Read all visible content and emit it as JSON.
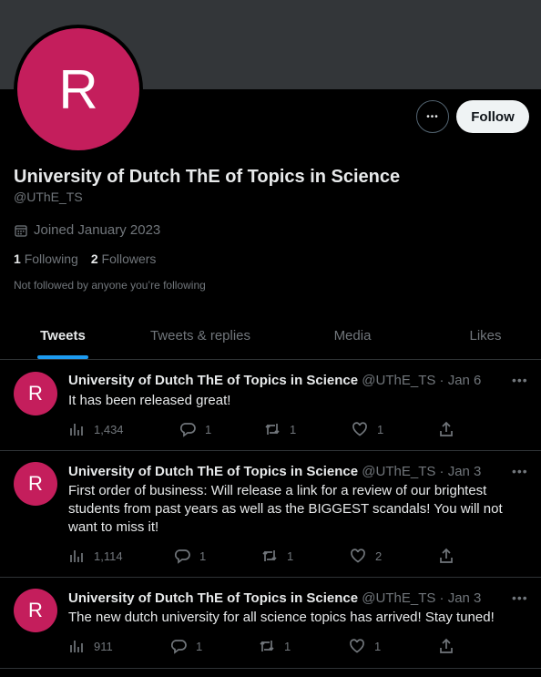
{
  "profile": {
    "avatar_letter": "R",
    "avatar_color": "#c41e5c",
    "name": "University of Dutch ThE of Topics in Science",
    "handle": "@UThE_TS",
    "joined": "Joined January 2023",
    "following_count": "1",
    "following_label": "Following",
    "followers_count": "2",
    "followers_label": "Followers",
    "not_followed": "Not followed by anyone you’re following"
  },
  "actions": {
    "follow_label": "Follow",
    "more_label": "•••"
  },
  "tabs": [
    {
      "label": "Tweets",
      "active": true
    },
    {
      "label": "Tweets & replies",
      "active": false
    },
    {
      "label": "Media",
      "active": false
    },
    {
      "label": "Likes",
      "active": false
    }
  ],
  "tweets": [
    {
      "name": "University of Dutch ThE of Topics in Science",
      "meta": "@UThE_TS · Jan 6",
      "text": "It has been released great!",
      "views": "1,434",
      "replies": "1",
      "retweets": "1",
      "likes": "1"
    },
    {
      "name": "University of Dutch ThE of Topics in Science",
      "meta": "@UThE_TS · Jan 3",
      "text": "First order of business: Will release a link for a review of our brightest students from past years as well as the BIGGEST scandals! You will not want to miss it!",
      "views": "1,114",
      "replies": "1",
      "retweets": "1",
      "likes": "2"
    },
    {
      "name": "University of Dutch ThE of Topics in Science",
      "meta": "@UThE_TS · Jan 3",
      "text": "The new dutch university for all science topics has arrived! Stay tuned!",
      "views": "911",
      "replies": "1",
      "retweets": "1",
      "likes": "1"
    }
  ],
  "colors": {
    "background": "#000000",
    "banner": "#333639",
    "accent": "#1d9bf0",
    "muted_text": "#71767b"
  }
}
